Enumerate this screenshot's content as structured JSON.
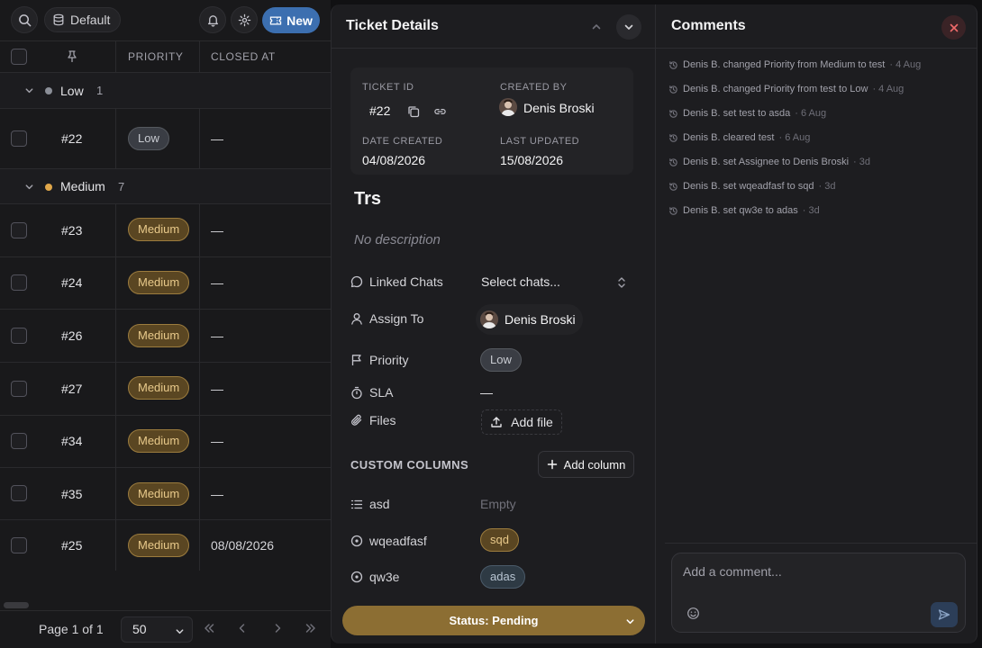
{
  "toolbar": {
    "view_label": "Default",
    "new_label": "New"
  },
  "table": {
    "columns": {
      "priority": "PRIORITY",
      "closed_at": "CLOSED AT"
    },
    "groups": [
      {
        "name": "Low",
        "count": "1",
        "color": "#8b8f98",
        "rows": [
          {
            "id": "#22",
            "priority": "Low",
            "closed": "—"
          }
        ]
      },
      {
        "name": "Medium",
        "count": "7",
        "color": "#e0a74a",
        "rows": [
          {
            "id": "#23",
            "priority": "Medium",
            "closed": "—"
          },
          {
            "id": "#24",
            "priority": "Medium",
            "closed": "—"
          },
          {
            "id": "#26",
            "priority": "Medium",
            "closed": "—"
          },
          {
            "id": "#27",
            "priority": "Medium",
            "closed": "—"
          },
          {
            "id": "#34",
            "priority": "Medium",
            "closed": "—"
          },
          {
            "id": "#35",
            "priority": "Medium",
            "closed": "—"
          },
          {
            "id": "#25",
            "priority": "Medium",
            "closed": "08/08/2026"
          }
        ]
      }
    ]
  },
  "pagination": {
    "page_label": "Page 1 of 1",
    "per_page": "50"
  },
  "details": {
    "title": "Ticket Details",
    "ticket_id_label": "TICKET ID",
    "ticket_id": "#22",
    "created_by_label": "CREATED BY",
    "created_by": "Denis Broski",
    "date_created_label": "DATE CREATED",
    "date_created": "04/08/2026",
    "last_updated_label": "LAST UPDATED",
    "last_updated": "15/08/2026",
    "ticket_title": "Trs",
    "description": "No description",
    "linked_chats_label": "Linked Chats",
    "linked_chats_value": "Select chats...",
    "assign_label": "Assign To",
    "assignee": "Denis Broski",
    "priority_label": "Priority",
    "priority": "Low",
    "sla_label": "SLA",
    "sla": "—",
    "files_label": "Files",
    "add_file": "Add file",
    "custom_columns_title": "CUSTOM COLUMNS",
    "add_column": "Add column",
    "custom": [
      {
        "name": "asd",
        "value": "Empty"
      },
      {
        "name": "wqeadfasf",
        "value": "sqd"
      },
      {
        "name": "qw3e",
        "value": "adas"
      }
    ],
    "status": "Status: Pending"
  },
  "comments": {
    "title": "Comments",
    "activity": [
      {
        "text": "Denis B. changed Priority from Medium to test",
        "when": "· 4 Aug"
      },
      {
        "text": "Denis B. changed Priority from test to Low",
        "when": "· 4 Aug"
      },
      {
        "text": "Denis B. set test to asda",
        "when": "· 6 Aug"
      },
      {
        "text": "Denis B. cleared test",
        "when": "· 6 Aug"
      },
      {
        "text": "Denis B. set Assignee to Denis Broski",
        "when": "· 3d"
      },
      {
        "text": "Denis B. set wqeadfasf to sqd",
        "when": "· 3d"
      },
      {
        "text": "Denis B. set qw3e to adas",
        "when": "· 3d"
      }
    ],
    "placeholder": "Add a comment..."
  }
}
